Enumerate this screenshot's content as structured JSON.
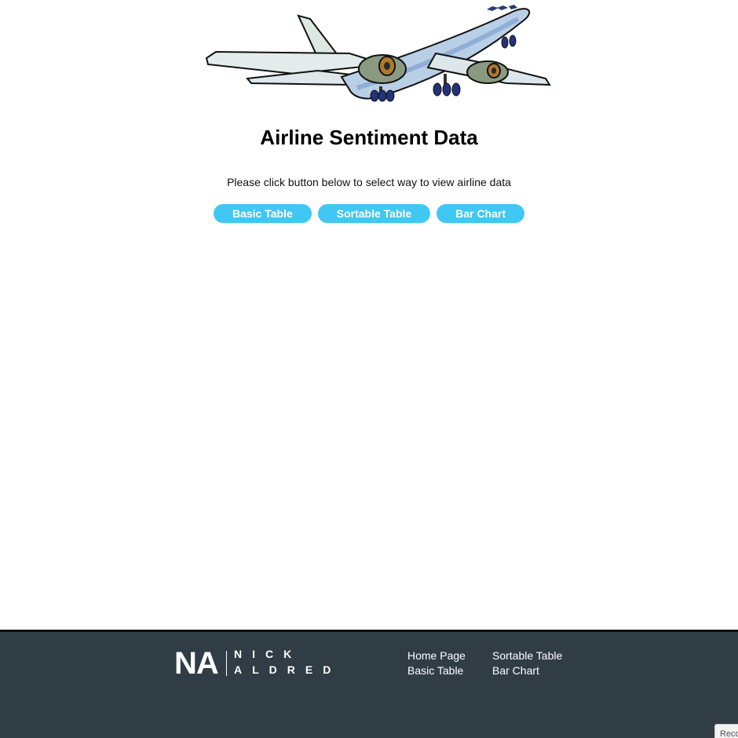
{
  "hero": {
    "image_icon": "airplane-icon"
  },
  "header": {
    "title": "Airline Sentiment Data",
    "subtitle": "Please click button below to select way to view airline data"
  },
  "buttons": {
    "basic_table": "Basic Table",
    "sortable_table": "Sortable Table",
    "bar_chart": "Bar Chart"
  },
  "footer": {
    "logo": {
      "initials": "NA",
      "line1": "NICK",
      "line2": "ALDRED"
    },
    "links": {
      "home_page": "Home Page",
      "basic_table": "Basic Table",
      "sortable_table": "Sortable Table",
      "bar_chart": "Bar Chart"
    }
  },
  "corner_badge": {
    "text": "Reco"
  },
  "colors": {
    "button_bg": "#40c7f4",
    "footer_bg": "#303d45"
  }
}
